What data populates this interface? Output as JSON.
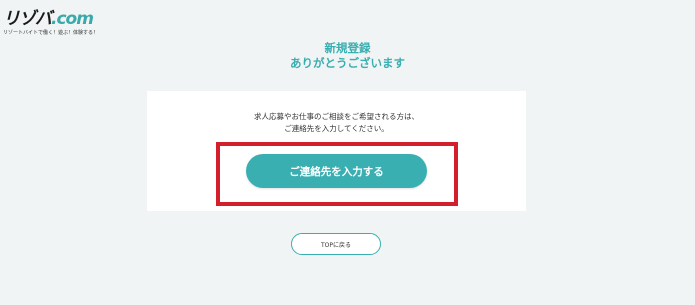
{
  "logo": {
    "text_main": "リゾバ",
    "text_accent": ".com",
    "tagline": "リゾートバイトで働く！遊ぶ！体験する！"
  },
  "heading": {
    "line1": "新規登録",
    "line2": "ありがとうございます"
  },
  "card": {
    "message_line1": "求人応募やお仕事のご相談をご希望される方は、",
    "message_line2": "ご連絡先を入力してください。",
    "cta_label": "ご連絡先を入力する"
  },
  "top_button_label": "TOPに戻る",
  "colors": {
    "accent": "#3aafb2",
    "highlight": "#d21f2b",
    "background": "#f1f4f4"
  }
}
